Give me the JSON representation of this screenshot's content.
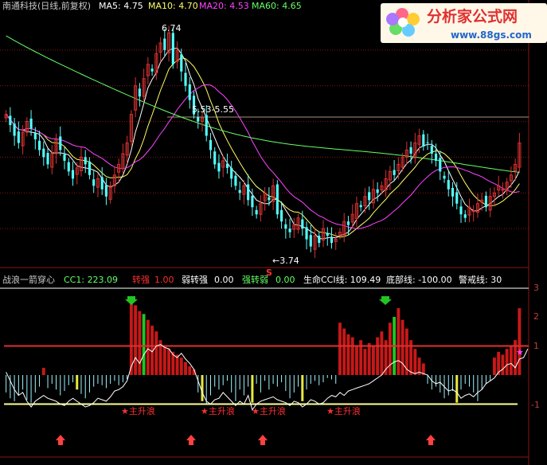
{
  "colors": {
    "background": "#000000",
    "up_candle": "#d83030",
    "down_candle": "#54ffff",
    "ma5": "#ffffff",
    "ma10": "#ffff66",
    "ma20": "#ff44ff",
    "ma60": "#66ff66",
    "grid": "#8a1515",
    "cci_line": "#ffffff",
    "red_hist": "#c81818",
    "cyan_hist": "#9ff4ff",
    "green_hist": "#22c422",
    "yellow_hist": "#e8e840",
    "bottom_line": "#ffff99",
    "warn_line": "#e03030"
  },
  "header": {
    "title": "南通科技(日线,前复权)",
    "ma5_label": "MA5: 4.75",
    "ma10_label": "MA10: 4.70",
    "ma20_label": "MA20: 4.53",
    "ma60_label": "MA60: 4.65"
  },
  "logo": {
    "brand": "分析家公式网",
    "url": "www.88gs.com"
  },
  "sub_header": {
    "name": "战浪一箭穿心",
    "cc1": "CC1: 223.09",
    "weak_to_strong_name": "转强",
    "weak_to_strong_val": "1.00",
    "weak_to_strong2_name": "弱转强",
    "weak_to_strong2_val": "0.00",
    "strong_to_weak_name": "强转弱",
    "strong_to_weak_val": "0.00",
    "life_cci": "生命CCI线: 109.49",
    "bottom_line": "底部线: -100.00",
    "warn_line": "警戒线: 30"
  },
  "annotations": {
    "high": "6.74",
    "range": "5.53-5.55",
    "low": "←3.74",
    "s_mark": "S",
    "star_label": "★主升浪"
  },
  "chart_data": [
    {
      "type": "candlestick",
      "title": "南通科技(日线,前复权)",
      "series": [
        {
          "name": "MA5",
          "last": 4.75
        },
        {
          "name": "MA10",
          "last": 4.7
        },
        {
          "name": "MA20",
          "last": 4.53
        },
        {
          "name": "MA60",
          "last": 4.65
        }
      ],
      "ylim": [
        3.5,
        7.0
      ],
      "closes": [
        5.6,
        5.45,
        5.3,
        5.2,
        5.35,
        5.5,
        5.4,
        5.25,
        5.1,
        5.0,
        4.9,
        5.05,
        5.25,
        5.1,
        4.95,
        4.8,
        4.7,
        4.85,
        5.0,
        4.9,
        4.75,
        4.6,
        4.7,
        4.55,
        4.45,
        4.6,
        4.75,
        4.9,
        5.05,
        5.2,
        5.6,
        6.0,
        5.85,
        6.1,
        6.3,
        6.2,
        6.45,
        6.6,
        6.5,
        6.74,
        6.3,
        6.5,
        6.2,
        6.0,
        5.8,
        5.6,
        5.5,
        5.55,
        5.3,
        5.1,
        4.9,
        4.8,
        4.95,
        4.85,
        4.7,
        4.6,
        4.5,
        4.6,
        4.4,
        4.3,
        4.2,
        4.35,
        4.5,
        4.4,
        4.6,
        4.2,
        4.1,
        4.0,
        3.95,
        4.05,
        4.15,
        4.0,
        3.85,
        3.75,
        3.9,
        3.8,
        4.0,
        3.9,
        3.8,
        3.85,
        3.95,
        4.1,
        4.05,
        4.2,
        4.35,
        4.3,
        4.45,
        4.4,
        4.55,
        4.5,
        4.6,
        4.7,
        4.8,
        4.75,
        4.9,
        5.0,
        5.1,
        5.05,
        5.2,
        5.3,
        5.15,
        5.2,
        5.05,
        4.95,
        4.8,
        4.7,
        4.55,
        4.45,
        4.35,
        4.2,
        4.15,
        4.3,
        4.25,
        4.35,
        4.4,
        4.3,
        4.45,
        4.5,
        4.6,
        4.55,
        4.65,
        4.75,
        4.9,
        5.2
      ],
      "annotations": [
        "6.74",
        "5.53-5.55",
        "←3.74",
        "S"
      ]
    },
    {
      "type": "bar",
      "title": "战浪一箭穿心",
      "series": [
        {
          "name": "CC1",
          "last": 223.09
        },
        {
          "name": "生命CCI线",
          "last": 109.49
        },
        {
          "name": "底部线",
          "value": -100.0
        },
        {
          "name": "警戒线",
          "value": 30
        }
      ],
      "yticks": [
        "3",
        "2",
        "1",
        "-1"
      ],
      "ylim": [
        -1.5,
        3.5
      ],
      "values": [
        -0.6,
        -0.8,
        -0.9,
        -0.7,
        -0.5,
        -0.85,
        -0.95,
        -0.6,
        -0.4,
        0.25,
        -0.45,
        -0.3,
        -0.5,
        -0.7,
        -0.55,
        -0.35,
        -0.25,
        -0.5,
        -0.65,
        -0.8,
        -0.6,
        -0.4,
        -0.3,
        -0.35,
        -0.45,
        -0.3,
        -0.2,
        -0.35,
        -0.25,
        -0.15,
        2.5,
        2.4,
        2.2,
        2.1,
        1.9,
        1.7,
        1.5,
        1.2,
        1.0,
        0.9,
        0.8,
        0.7,
        0.6,
        0.45,
        0.3,
        0.2,
        -0.6,
        -0.9,
        -1.0,
        -0.7,
        -0.4,
        -0.5,
        -0.35,
        -0.2,
        -0.6,
        -0.9,
        -0.5,
        -0.7,
        -0.4,
        -0.95,
        -0.3,
        -0.6,
        -0.2,
        -0.5,
        -0.3,
        -0.4,
        -0.25,
        -0.55,
        -0.8,
        -0.6,
        -0.4,
        -0.9,
        -0.5,
        -0.3,
        -0.2,
        -0.35,
        -0.25,
        -0.1,
        -0.15,
        -0.3,
        1.8,
        1.6,
        1.4,
        1.3,
        1.0,
        1.2,
        0.9,
        1.1,
        1.0,
        1.3,
        1.5,
        1.2,
        1.8,
        2.0,
        2.3,
        1.9,
        1.6,
        1.2,
        0.9,
        0.6,
        0.4,
        -0.3,
        -0.5,
        -0.4,
        -0.6,
        -0.8,
        -0.7,
        -0.55,
        -0.95,
        -0.5,
        -0.3,
        -0.4,
        -0.6,
        -0.9,
        -0.5,
        -0.3,
        -0.2,
        0.6,
        0.8,
        0.7,
        0.9,
        1.0,
        1.2,
        2.3
      ],
      "cci": [
        0.1,
        -0.2,
        -0.5,
        -0.7,
        -0.6,
        -0.9,
        -1.1,
        -0.9,
        -0.8,
        -0.7,
        -0.8,
        -0.85,
        -0.9,
        -1.0,
        -1.05,
        -0.9,
        -0.8,
        -0.9,
        -1.0,
        -1.1,
        -1.05,
        -0.95,
        -0.8,
        -0.85,
        -0.9,
        -0.75,
        -0.55,
        -0.5,
        -0.4,
        -0.2,
        0.3,
        0.6,
        0.4,
        0.7,
        0.9,
        0.8,
        1.0,
        1.05,
        0.95,
        0.9,
        0.7,
        0.6,
        0.75,
        0.55,
        0.4,
        0.2,
        -0.2,
        -0.6,
        -0.9,
        -1.0,
        -0.85,
        -0.8,
        -0.6,
        -0.75,
        -0.9,
        -1.05,
        -0.9,
        -1.0,
        -0.7,
        -1.2,
        -1.0,
        -0.9,
        -0.85,
        -0.8,
        -0.75,
        -0.85,
        -0.9,
        -0.95,
        -1.05,
        -0.9,
        -0.95,
        -1.1,
        -1.0,
        -0.85,
        -0.9,
        -1.0,
        -0.95,
        -0.8,
        -0.7,
        -0.75,
        -0.6,
        -0.7,
        -0.55,
        -0.5,
        -0.45,
        -0.4,
        -0.35,
        -0.3,
        -0.2,
        -0.1,
        0.0,
        0.2,
        0.35,
        0.45,
        0.5,
        0.4,
        0.2,
        0.1,
        0.05,
        0.1,
        0.05,
        0.0,
        -0.2,
        -0.3,
        -0.25,
        -0.4,
        -0.55,
        -0.5,
        -0.6,
        -0.8,
        -0.7,
        -0.65,
        -0.75,
        -0.6,
        -0.5,
        -0.3,
        -0.2,
        -0.1,
        0.1,
        0.2,
        0.35,
        0.4,
        0.25,
        0.55,
        0.6,
        0.9
      ]
    }
  ]
}
